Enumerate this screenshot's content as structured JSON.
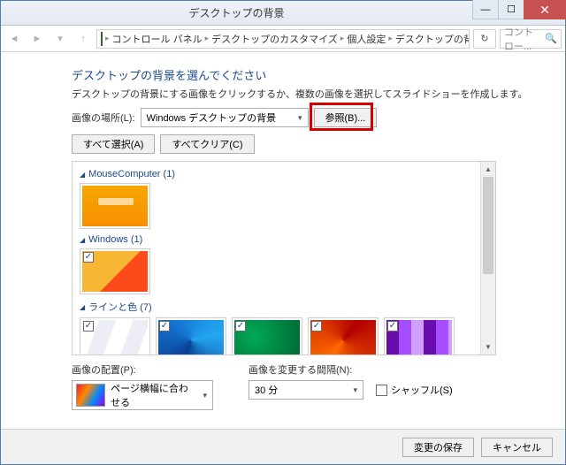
{
  "window": {
    "title": "デスクトップの背景"
  },
  "breadcrumb": {
    "items": [
      "コントロール パネル",
      "デスクトップのカスタマイズ",
      "個人設定",
      "デスクトップの背景"
    ]
  },
  "search": {
    "placeholder": "コントロー..."
  },
  "heading": "デスクトップの背景を選んでください",
  "subheading": "デスクトップの背景にする画像をクリックするか、複数の画像を選択してスライドショーを作成します。",
  "location": {
    "label": "画像の場所(L):",
    "value": "Windows デスクトップの背景",
    "browse": "参照(B)..."
  },
  "select_all": "すべて選択(A)",
  "clear_all": "すべてクリア(C)",
  "groups": {
    "g1": {
      "label": "MouseComputer (1)"
    },
    "g2": {
      "label": "Windows (1)"
    },
    "g3": {
      "label": "ラインと色 (7)"
    }
  },
  "placement": {
    "label": "画像の配置(P):",
    "value": "ページ横幅に合わせる"
  },
  "interval": {
    "label": "画像を変更する間隔(N):",
    "value": "30 分"
  },
  "shuffle": {
    "label": "シャッフル(S)"
  },
  "footer": {
    "save": "変更の保存",
    "cancel": "キャンセル"
  }
}
